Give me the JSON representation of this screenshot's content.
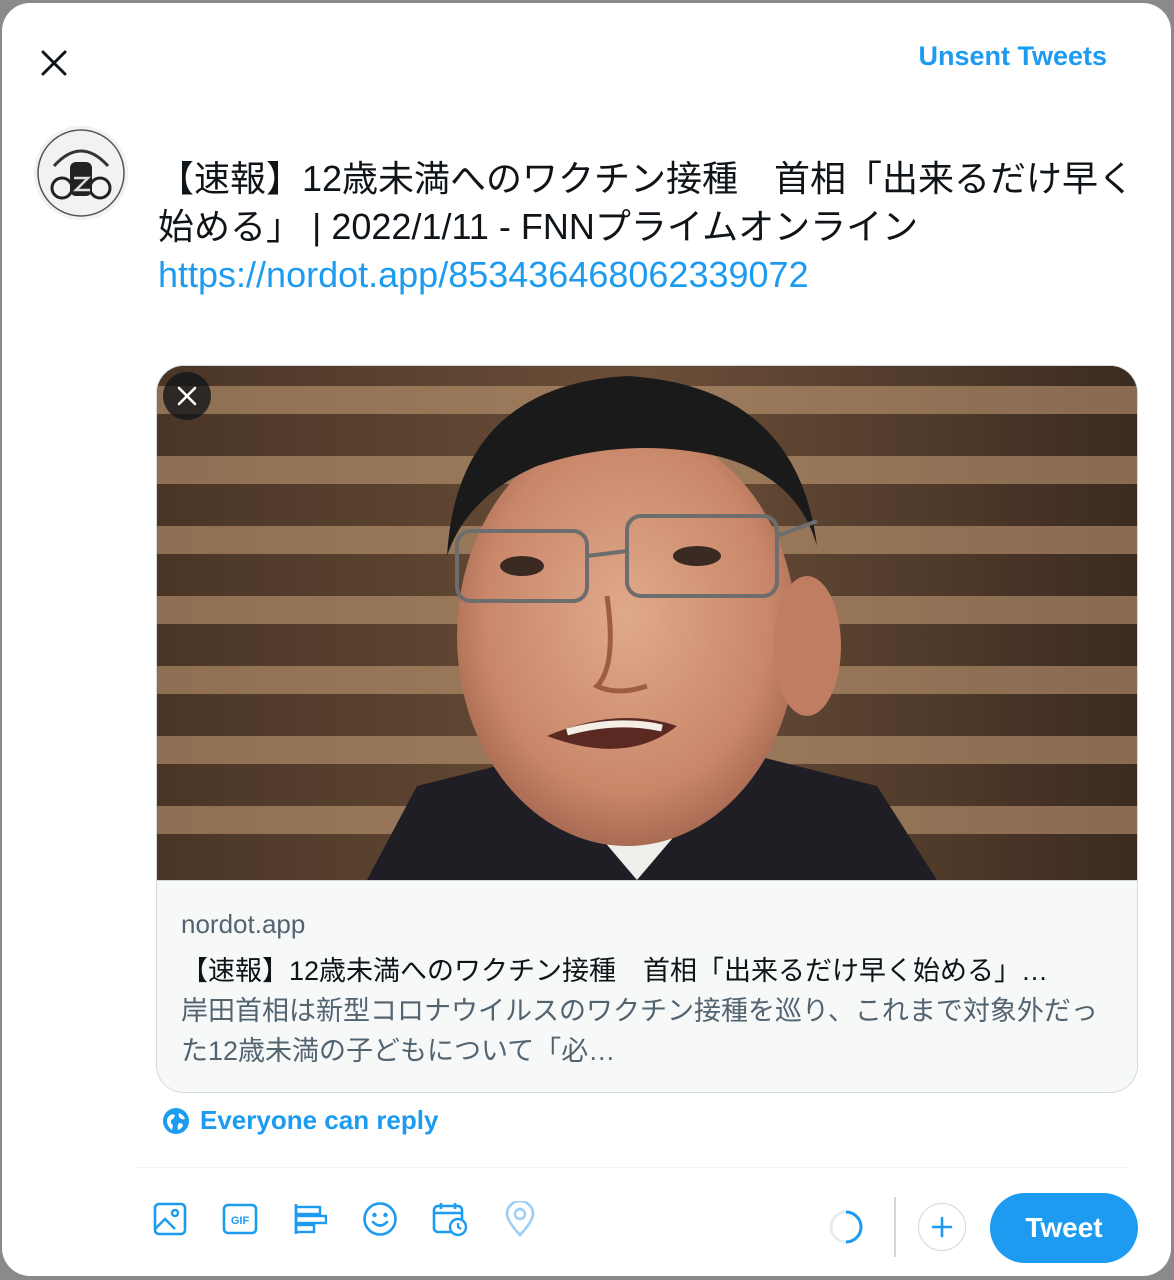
{
  "header": {
    "close_icon": "close-icon",
    "unsent_label": "Unsent Tweets"
  },
  "composer": {
    "avatar_icon": "profile-avatar",
    "text": "【速報】12歳未満へのワクチン接種　首相「出来るだけ早く始める」 | 2022/1/11 - FNNプライムオンライン",
    "link": "https://nordot.app/853436468062339072"
  },
  "card": {
    "remove_icon": "close-icon",
    "domain": "nordot.app",
    "title": "【速報】12歳未満へのワクチン接種　首相「出来るだけ早く始める」…",
    "description": "岸田首相は新型コロナウイルスのワクチン接種を巡り、これまで対象外だった12歳未満の子どもについて「必…"
  },
  "reply_setting": {
    "icon": "globe-icon",
    "label": "Everyone can reply"
  },
  "toolbar": {
    "icons": [
      "image-icon",
      "gif-icon",
      "poll-icon",
      "emoji-icon",
      "schedule-icon",
      "location-icon"
    ],
    "progress_icon": "char-progress-ring",
    "add_icon": "plus-icon",
    "tweet_label": "Tweet"
  },
  "colors": {
    "accent": "#1d9bf0",
    "text": "#0f1419",
    "secondary": "#536471",
    "border": "#cfd9de"
  }
}
